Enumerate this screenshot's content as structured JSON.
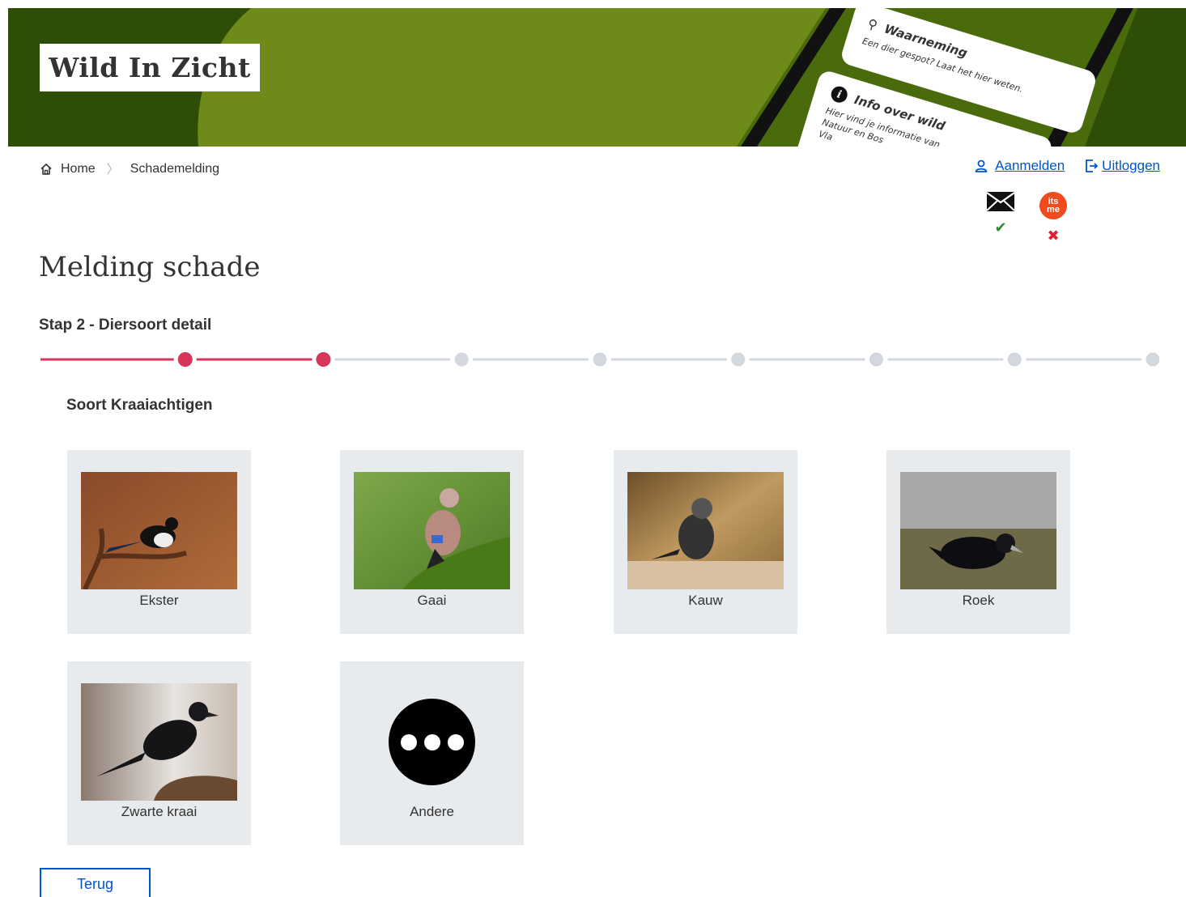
{
  "header": {
    "logo_text": "Wild In Zicht",
    "card1": {
      "title": "Waarneming",
      "subtitle": "Een dier gespot? Laat het hier weten."
    },
    "card2": {
      "title": "Info over wild",
      "subtitle_line1": "Hier vind je informatie van",
      "subtitle_line2": "Natuur en Bos",
      "subtitle_line3": "Vla"
    }
  },
  "breadcrumb": {
    "home": "Home",
    "current": "Schademelding"
  },
  "auth": {
    "login": "Aanmelden",
    "logout": "Uitloggen"
  },
  "identity": {
    "itsme_line1": "its",
    "itsme_line2": "me",
    "mail_status": "✔",
    "itsme_status": "✖"
  },
  "page": {
    "title": "Melding schade",
    "step": "Stap 2 - Diersoort detail",
    "section": "Soort Kraaiachtigen"
  },
  "stepper": {
    "total_steps": 9,
    "current_step": 2
  },
  "species": [
    {
      "name": "Ekster"
    },
    {
      "name": "Gaai"
    },
    {
      "name": "Kauw"
    },
    {
      "name": "Roek"
    },
    {
      "name": "Zwarte kraai"
    },
    {
      "name": "Andere"
    }
  ],
  "buttons": {
    "back": "Terug"
  },
  "colors": {
    "accent_red": "#d6365a",
    "link_blue": "#0055cc",
    "banner_dark": "#2e4d06",
    "banner_light": "#6e8a18",
    "tile_bg": "#e8ebee",
    "step_inactive": "#d3d8de"
  }
}
